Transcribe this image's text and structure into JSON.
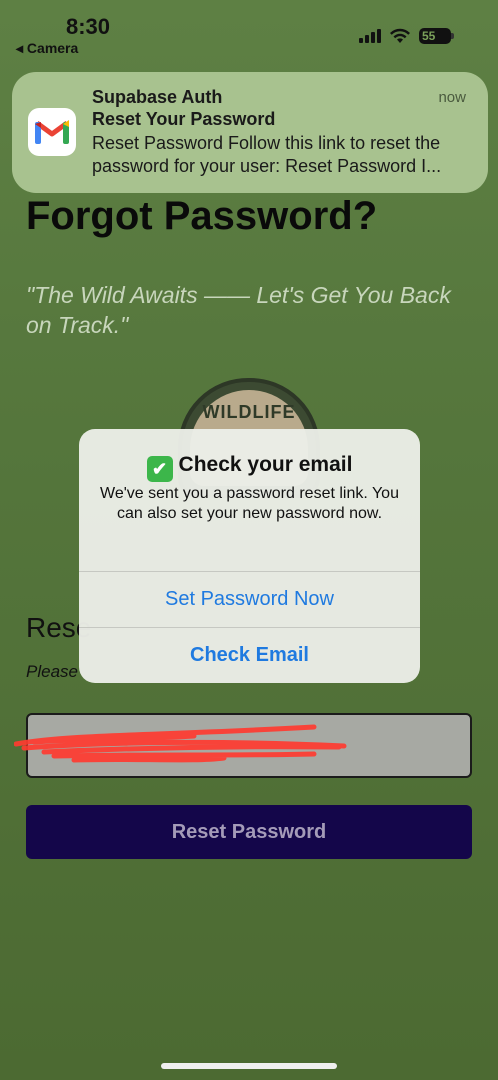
{
  "status_bar": {
    "time": "8:30",
    "back_label": "◂ Camera",
    "battery": "55"
  },
  "notification": {
    "app_name": "Supabase Auth",
    "time": "now",
    "title": "Reset Your Password",
    "body": "Reset Password Follow this link to reset the password for your user: Reset Password I...",
    "icon": "gmail-icon"
  },
  "page": {
    "title": "Forgot Password?",
    "tagline": "\"The Wild Awaits —— Let's Get You Back on Track.\"",
    "badge_text": "WILDLIFE",
    "reset_heading": "Rese",
    "reset_sub": "Please",
    "reset_button": "Reset Password"
  },
  "alert": {
    "emoji": "✔",
    "title": "Check your email",
    "message": "We've sent you a password reset link. You can also set your new password now.",
    "primary_action": "Set Password Now",
    "secondary_action": "Check Email"
  },
  "colors": {
    "background": "#55763c",
    "button_bg": "#14064a",
    "link_blue": "#1f7ae0",
    "check_green": "#3cb64a"
  }
}
